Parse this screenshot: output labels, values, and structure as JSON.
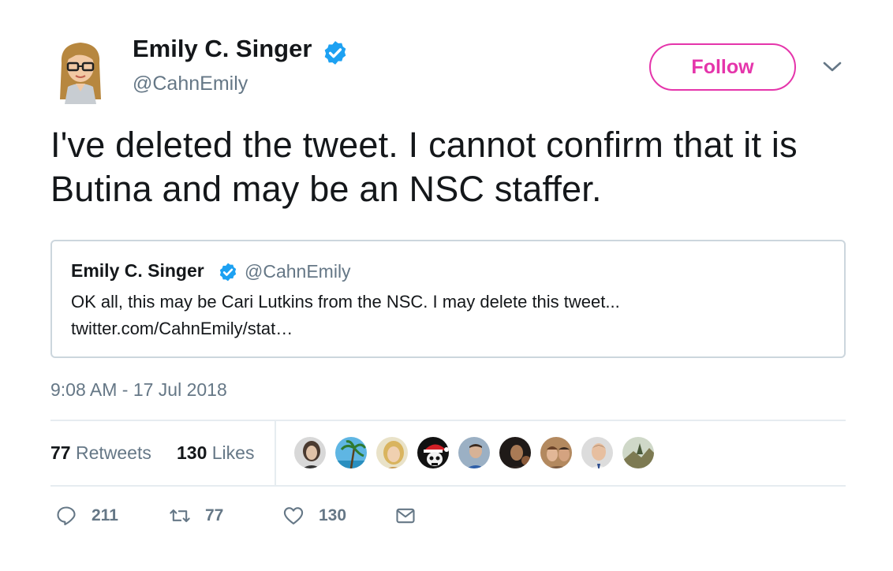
{
  "author": {
    "name": "Emily C. Singer",
    "handle": "@CahnEmily",
    "verified_color": "#1da1f2"
  },
  "follow_button": {
    "label": "Follow",
    "color": "#e535ab"
  },
  "tweet": {
    "text": "I've deleted the tweet. I cannot confirm that it is Butina and may be an NSC staffer.",
    "timestamp": "9:08 AM - 17 Jul 2018"
  },
  "quoted_tweet": {
    "name": "Emily C. Singer",
    "handle": "@CahnEmily",
    "text": "OK all, this may be Cari Lutkins from the NSC. I may delete this tweet...",
    "link": "twitter.com/CahnEmily/stat…"
  },
  "stats": {
    "retweets_count": "77",
    "retweets_label": "Retweets",
    "likes_count": "130",
    "likes_label": "Likes"
  },
  "liker_avatars": [
    "woman-portrait-avatar",
    "palm-beach-avatar",
    "blonde-woman-avatar",
    "santa-skull-avatar",
    "man-blue-shirt-avatar",
    "dark-portrait-avatar",
    "couple-avatar",
    "bald-man-avatar",
    "landscape-avatar"
  ],
  "actions": {
    "replies": "211",
    "retweets": "77",
    "likes": "130",
    "icons": [
      "reply-icon",
      "retweet-icon",
      "like-icon",
      "direct-message-icon"
    ]
  },
  "colors": {
    "text": "#14171a",
    "secondary_text": "#657786",
    "border": "#ccd6dd",
    "divider": "#e6ecf0"
  }
}
